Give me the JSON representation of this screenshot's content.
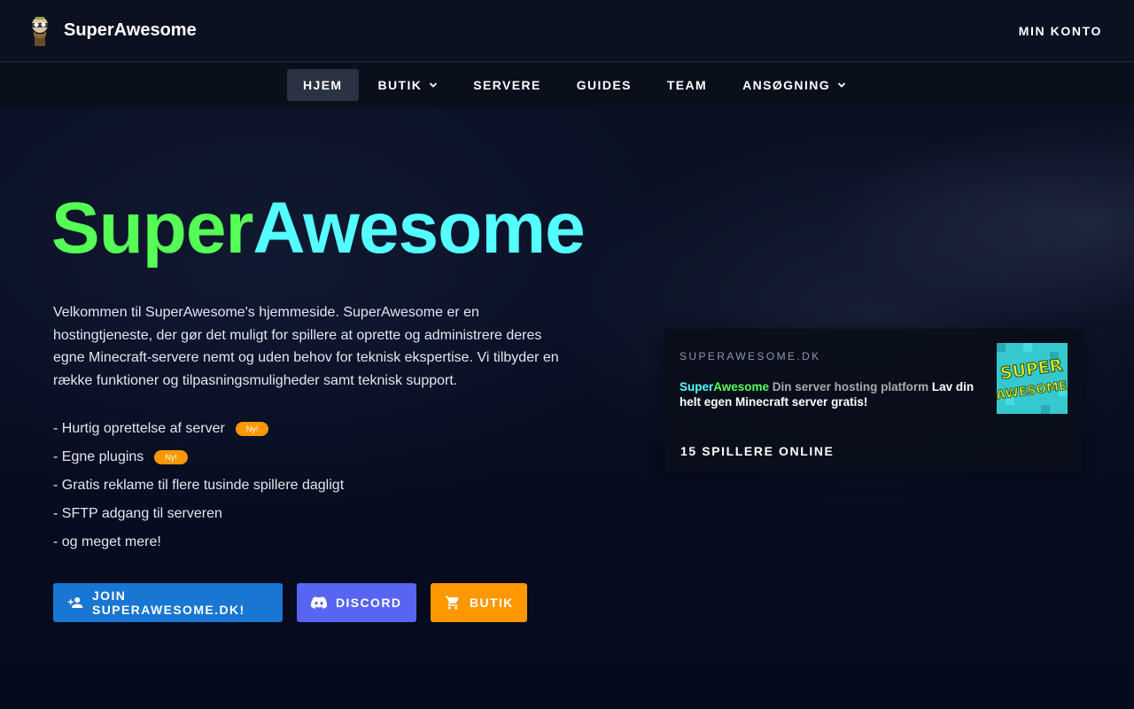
{
  "header": {
    "brand": "SuperAwesome",
    "logo_icon": "cartoon-character-icon",
    "account_label": "MIN KONTO"
  },
  "nav": {
    "items": [
      {
        "label": "HJEM",
        "active": true,
        "dropdown": false
      },
      {
        "label": "BUTIK",
        "active": false,
        "dropdown": true
      },
      {
        "label": "SERVERE",
        "active": false,
        "dropdown": false
      },
      {
        "label": "GUIDES",
        "active": false,
        "dropdown": false
      },
      {
        "label": "TEAM",
        "active": false,
        "dropdown": false
      },
      {
        "label": "ANSØGNING",
        "active": false,
        "dropdown": true
      }
    ]
  },
  "hero": {
    "title_part1": "Super",
    "title_part2": "Awesome",
    "intro": "Velkommen til SuperAwesome's hjemmeside. SuperAwesome er en hostingtjeneste, der gør det muligt for spillere at oprette og administrere deres egne Minecraft-servere nemt og uden behov for teknisk ekspertise. Vi tilbyder en række funktioner og tilpasningsmuligheder samt teknisk support.",
    "features": [
      {
        "text": "- Hurtig oprettelse af server",
        "badge": "Ny!"
      },
      {
        "text": "- Egne plugins",
        "badge": "Ny!"
      },
      {
        "text": "- Gratis reklame til flere tusinde spillere dagligt",
        "badge": ""
      },
      {
        "text": "- SFTP adgang til serveren",
        "badge": ""
      },
      {
        "text": "- og meget mere!",
        "badge": ""
      }
    ]
  },
  "buttons": {
    "join": "JOIN SUPERAWESOME.DK!",
    "discord": "DISCORD",
    "shop": "BUTIK"
  },
  "server_card": {
    "host": "SUPERAWESOME.DK",
    "motd_super": "Super",
    "motd_awesome": "Awesome",
    "motd_grey": " Din server hosting platform ",
    "motd_white": "Lav din helt egen Minecraft server gratis!",
    "players": "15 SPILLERE ONLINE",
    "logo_text_line1": "SUPER",
    "logo_text_line2": "AWESOME"
  },
  "colors": {
    "green": "#55ff55",
    "cyan": "#55ffff",
    "join_button": "#1976d2",
    "discord_button": "#5865f2",
    "shop_button": "#ff9800",
    "badge": "#ff9800"
  }
}
